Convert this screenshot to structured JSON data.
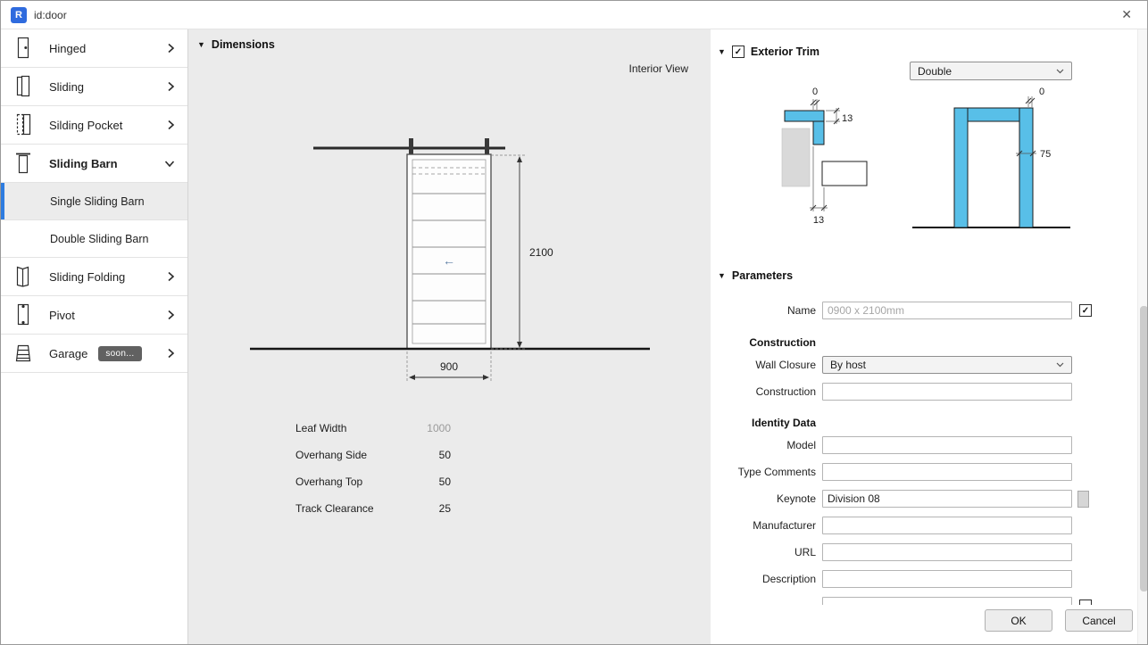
{
  "window": {
    "title": "id:door",
    "app_icon_letter": "R",
    "close_glyph": "✕"
  },
  "icons": {
    "check": "✓"
  },
  "sidebar": {
    "items": [
      {
        "label": "Hinged"
      },
      {
        "label": "Sliding"
      },
      {
        "label": "Silding Pocket"
      },
      {
        "label": "Sliding Barn"
      },
      {
        "label": "Single Sliding Barn"
      },
      {
        "label": "Double Sliding Barn"
      },
      {
        "label": "Sliding Folding"
      },
      {
        "label": "Pivot"
      },
      {
        "label": "Garage"
      }
    ],
    "garage_badge": "soon..."
  },
  "dimensions": {
    "header": "Dimensions",
    "view_label": "Interior View",
    "height_dim": "2100",
    "width_dim": "900",
    "slide_arrow": "←",
    "params": [
      {
        "label": "Leaf Width",
        "value": "1000"
      },
      {
        "label": "Overhang Side",
        "value": "50"
      },
      {
        "label": "Overhang Top",
        "value": "50"
      },
      {
        "label": "Track Clearance",
        "value": "25"
      }
    ]
  },
  "exterior_trim": {
    "header": "Exterior Trim",
    "style_value": "Double",
    "plan_dim_top": "0",
    "plan_dim_side": "13",
    "plan_dim_bottom": "13",
    "elev_dim_top": "0",
    "elev_dim_side": "75"
  },
  "parameters": {
    "header": "Parameters",
    "name_label": "Name",
    "name_value": "0900 x 2100mm",
    "construction_header": "Construction",
    "wall_closure_label": "Wall Closure",
    "wall_closure_value": "By host",
    "construction_label": "Construction",
    "construction_value": "",
    "identity_header": "Identity Data",
    "model_label": "Model",
    "model_value": "",
    "type_comments_label": "Type Comments",
    "type_comments_value": "",
    "keynote_label": "Keynote",
    "keynote_value": "Division 08",
    "manufacturer_label": "Manufacturer",
    "manufacturer_value": "",
    "url_label": "URL",
    "url_value": "",
    "description_label": "Description",
    "description_value": ""
  },
  "footer": {
    "ok_label": "OK",
    "cancel_label": "Cancel"
  }
}
